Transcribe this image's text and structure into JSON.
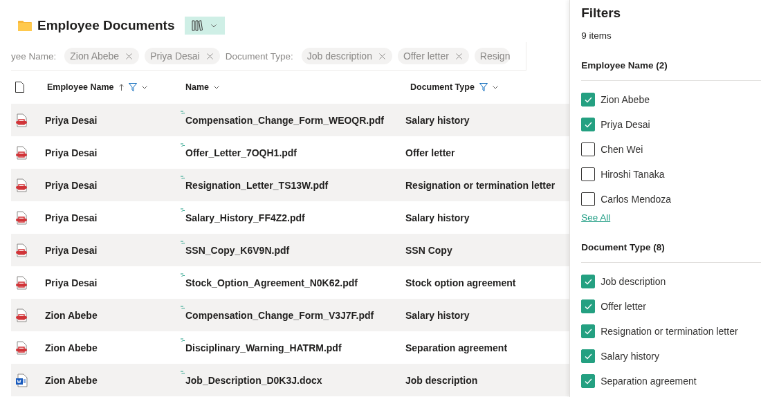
{
  "header": {
    "title": "Employee Documents"
  },
  "active_filters": [
    {
      "kind": "label",
      "text": "yee Name:"
    },
    {
      "kind": "chip",
      "text": "Zion Abebe"
    },
    {
      "kind": "chip",
      "text": "Priya Desai"
    },
    {
      "kind": "label",
      "text": "Document Type:"
    },
    {
      "kind": "chip",
      "text": "Job description"
    },
    {
      "kind": "chip",
      "text": "Offer letter"
    },
    {
      "kind": "cut_chip",
      "text": "Resign"
    }
  ],
  "table": {
    "columns": [
      {
        "label": "Employee Name",
        "sorted": true,
        "filtered": true
      },
      {
        "label": "Name",
        "sorted": false,
        "filtered": false
      },
      {
        "label": "Document Type",
        "sorted": false,
        "filtered": true
      }
    ],
    "rows": [
      {
        "kind": "pdf",
        "new": true,
        "employee": "Priya Desai",
        "name": "Compensation_Change_Form_WEOQR.pdf",
        "type": "Salary history"
      },
      {
        "kind": "pdf",
        "new": true,
        "employee": "Priya Desai",
        "name": "Offer_Letter_7OQH1.pdf",
        "type": "Offer letter"
      },
      {
        "kind": "pdf",
        "new": true,
        "employee": "Priya Desai",
        "name": "Resignation_Letter_TS13W.pdf",
        "type": "Resignation or termination letter"
      },
      {
        "kind": "pdf",
        "new": true,
        "employee": "Priya Desai",
        "name": "Salary_History_FF4Z2.pdf",
        "type": "Salary history"
      },
      {
        "kind": "pdf",
        "new": true,
        "employee": "Priya Desai",
        "name": "SSN_Copy_K6V9N.pdf",
        "type": "SSN Copy"
      },
      {
        "kind": "pdf",
        "new": true,
        "employee": "Priya Desai",
        "name": "Stock_Option_Agreement_N0K62.pdf",
        "type": "Stock option agreement"
      },
      {
        "kind": "pdf",
        "new": true,
        "employee": "Zion Abebe",
        "name": "Compensation_Change_Form_V3J7F.pdf",
        "type": "Salary history"
      },
      {
        "kind": "pdf",
        "new": true,
        "employee": "Zion Abebe",
        "name": "Disciplinary_Warning_HATRM.pdf",
        "type": "Separation agreement"
      },
      {
        "kind": "docx",
        "new": true,
        "employee": "Zion Abebe",
        "name": "Job_Description_D0K3J.docx",
        "type": "Job description"
      }
    ]
  },
  "filters_panel": {
    "title": "Filters",
    "count": "9 items",
    "groups": [
      {
        "title": "Employee Name (2)",
        "options": [
          {
            "label": "Zion Abebe",
            "checked": true
          },
          {
            "label": "Priya Desai",
            "checked": true
          },
          {
            "label": "Chen Wei",
            "checked": false
          },
          {
            "label": "Hiroshi Tanaka",
            "checked": false
          },
          {
            "label": "Carlos Mendoza",
            "checked": false
          }
        ],
        "link": "See All"
      },
      {
        "title": "Document Type (8)",
        "options": [
          {
            "label": "Job description",
            "checked": true
          },
          {
            "label": "Offer letter",
            "checked": true
          },
          {
            "label": "Resignation or termination letter",
            "checked": true
          },
          {
            "label": "Salary history",
            "checked": true
          },
          {
            "label": "Separation agreement",
            "checked": true
          }
        ]
      }
    ]
  }
}
